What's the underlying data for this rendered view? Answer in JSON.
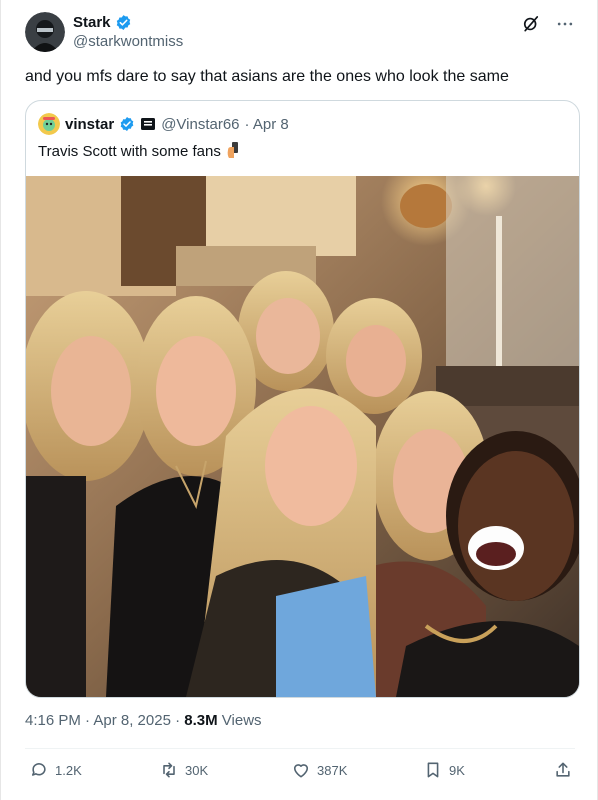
{
  "author": {
    "display_name": "Stark",
    "handle": "@starkwontmiss",
    "avatar_icon": "masked-person-avatar",
    "verified": true
  },
  "header_actions": {
    "grok_icon": "grok-icon",
    "more_icon": "more-icon"
  },
  "tweet": {
    "text": "and you mfs dare to say that asians are the ones who look the same"
  },
  "quote": {
    "display_name": "vinstar",
    "handle": "@Vinstar66",
    "date": "· Apr 8",
    "text": "Travis Scott with some fans",
    "emoji": "🤳",
    "avatar_icon": "cartoon-avatar",
    "verified": true,
    "affiliate_badge": "affiliate-badge"
  },
  "meta": {
    "time": "4:16 PM · Apr 8, 2025 · ",
    "views_count": "8.3M",
    "views_label": " Views"
  },
  "actions": {
    "replies": "1.2K",
    "reposts": "30K",
    "likes": "387K",
    "bookmarks": "9K"
  },
  "colors": {
    "verified_blue": "#1d9bf0",
    "text_primary": "#0f1419",
    "text_secondary": "#536471",
    "border": "#cfd9de"
  }
}
